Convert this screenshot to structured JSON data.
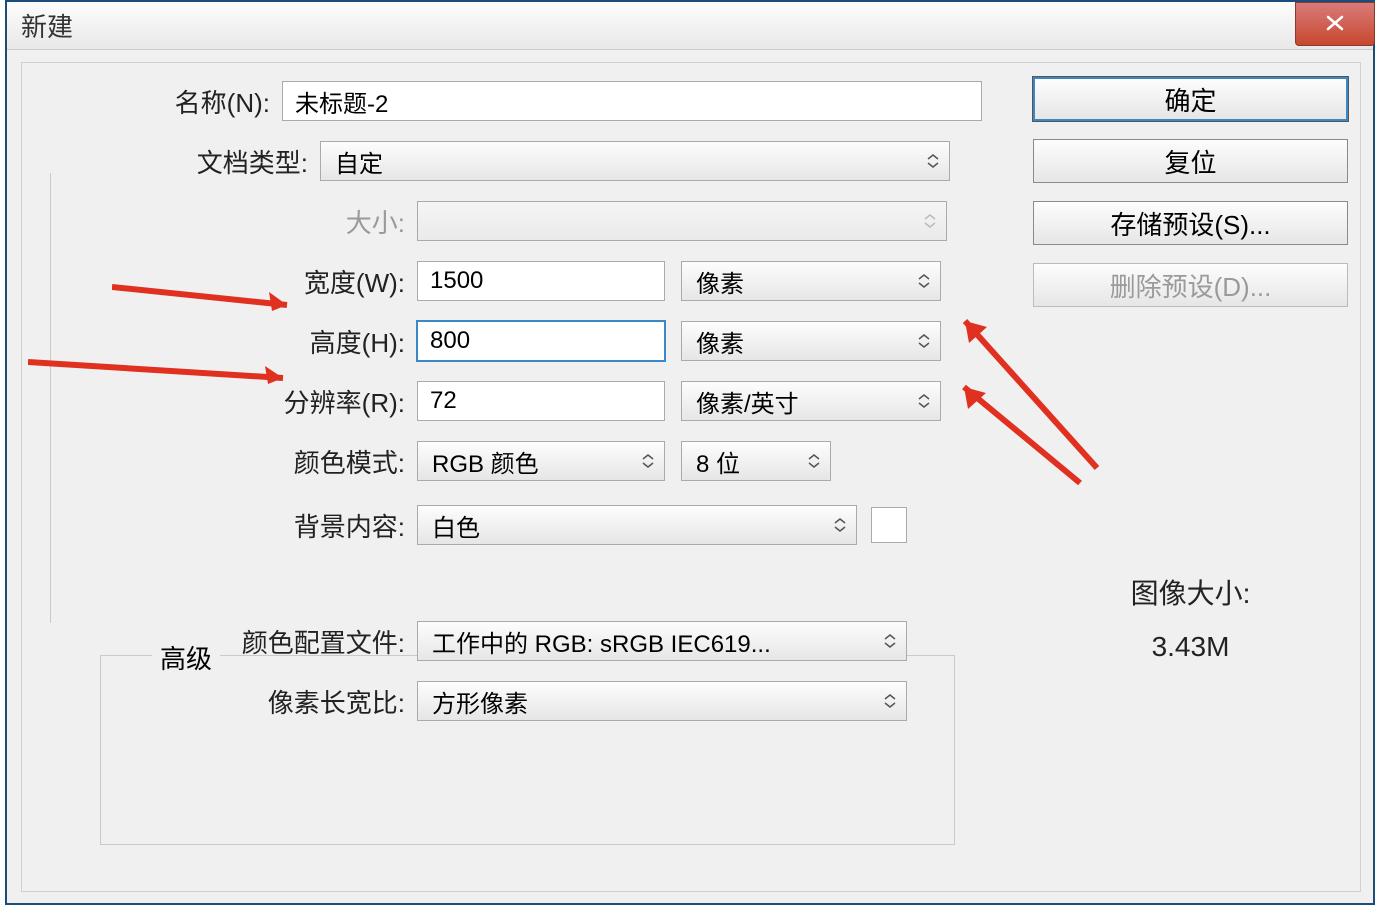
{
  "window": {
    "title": "新建"
  },
  "name": {
    "label": "名称(N):",
    "value": "未标题-2"
  },
  "docType": {
    "label": "文档类型:",
    "value": "自定"
  },
  "size": {
    "label": "大小:",
    "value": ""
  },
  "width": {
    "label": "宽度(W):",
    "value": "1500",
    "unit": "像素"
  },
  "height": {
    "label": "高度(H):",
    "value": "800",
    "unit": "像素"
  },
  "resolution": {
    "label": "分辨率(R):",
    "value": "72",
    "unit": "像素/英寸"
  },
  "colorMode": {
    "label": "颜色模式:",
    "value": "RGB 颜色",
    "depth": "8 位"
  },
  "background": {
    "label": "背景内容:",
    "value": "白色"
  },
  "advanced": {
    "legend": "高级",
    "profile": {
      "label": "颜色配置文件:",
      "value": "工作中的 RGB: sRGB IEC619..."
    },
    "aspect": {
      "label": "像素长宽比:",
      "value": "方形像素"
    }
  },
  "buttons": {
    "ok": "确定",
    "reset": "复位",
    "savePreset": "存储预设(S)...",
    "deletePreset": "删除预设(D)..."
  },
  "imageSize": {
    "label": "图像大小:",
    "value": "3.43M"
  }
}
